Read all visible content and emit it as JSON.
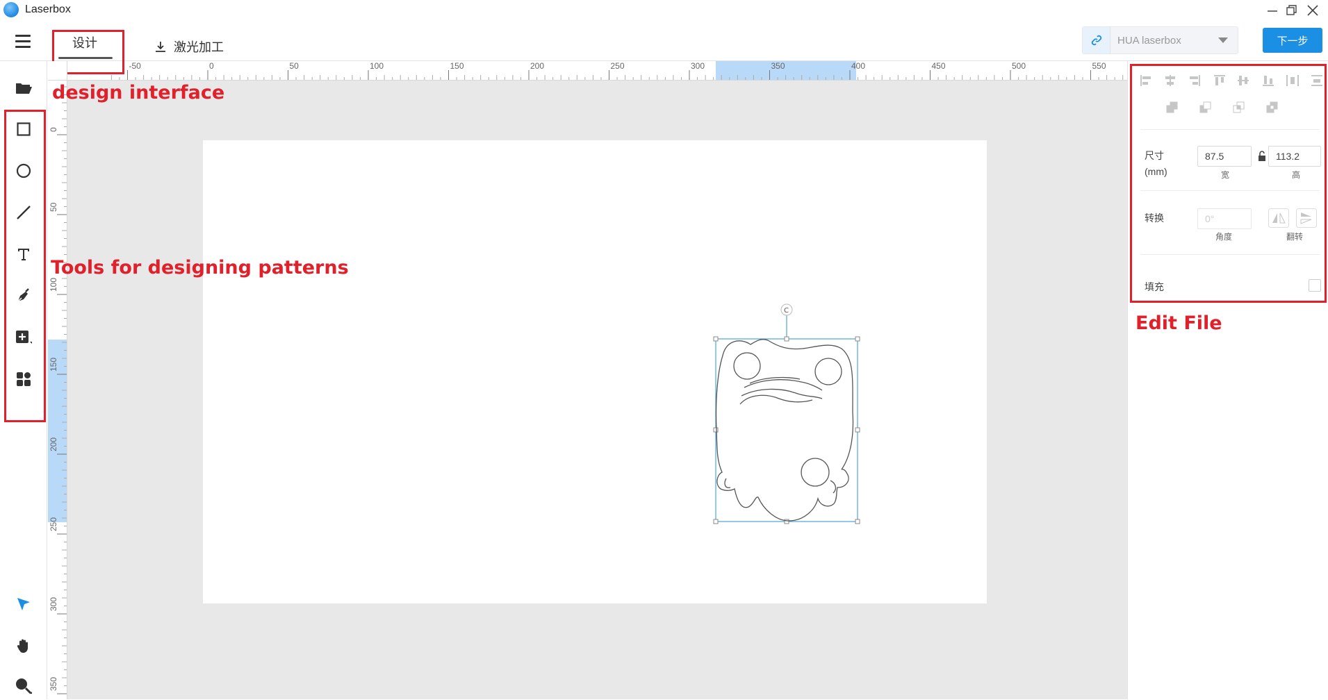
{
  "app": {
    "title": "Laserbox"
  },
  "tabs": {
    "design": "设计",
    "laser": "激光加工"
  },
  "device": {
    "name": "HUA laserbox"
  },
  "next_button": "下一步",
  "left_tools": [
    "folder-open-icon",
    "rectangle-tool-icon",
    "ellipse-tool-icon",
    "line-tool-icon",
    "text-tool-icon",
    "pen-tool-icon",
    "add-shape-icon",
    "elements-library-icon",
    "select-pointer-icon",
    "hand-pan-icon",
    "zoom-icon"
  ],
  "ruler": {
    "top_labels": [
      "-50",
      "0",
      "50",
      "100",
      "150",
      "200",
      "250",
      "300",
      "350",
      "400",
      "450",
      "500",
      "550"
    ],
    "left_labels": [
      "0",
      "50",
      "100",
      "150",
      "200",
      "250",
      "300",
      "350"
    ]
  },
  "properties": {
    "size_label": "尺寸",
    "size_unit": "(mm)",
    "width": "87.5",
    "height": "113.2",
    "width_label": "宽",
    "height_label": "高",
    "transform_label": "转换",
    "angle_placeholder": "0°",
    "angle_label": "角度",
    "flip_label": "翻转",
    "fill_label": "填充"
  },
  "annotations": {
    "design_interface": "design interface",
    "tools": "Tools for designing patterns",
    "edit_file": "Edit File"
  },
  "colors": {
    "accent": "#1a8fe3",
    "annotation": "#e0202a",
    "selection": "#4aa3df",
    "highlight": "#b8d9f7"
  }
}
